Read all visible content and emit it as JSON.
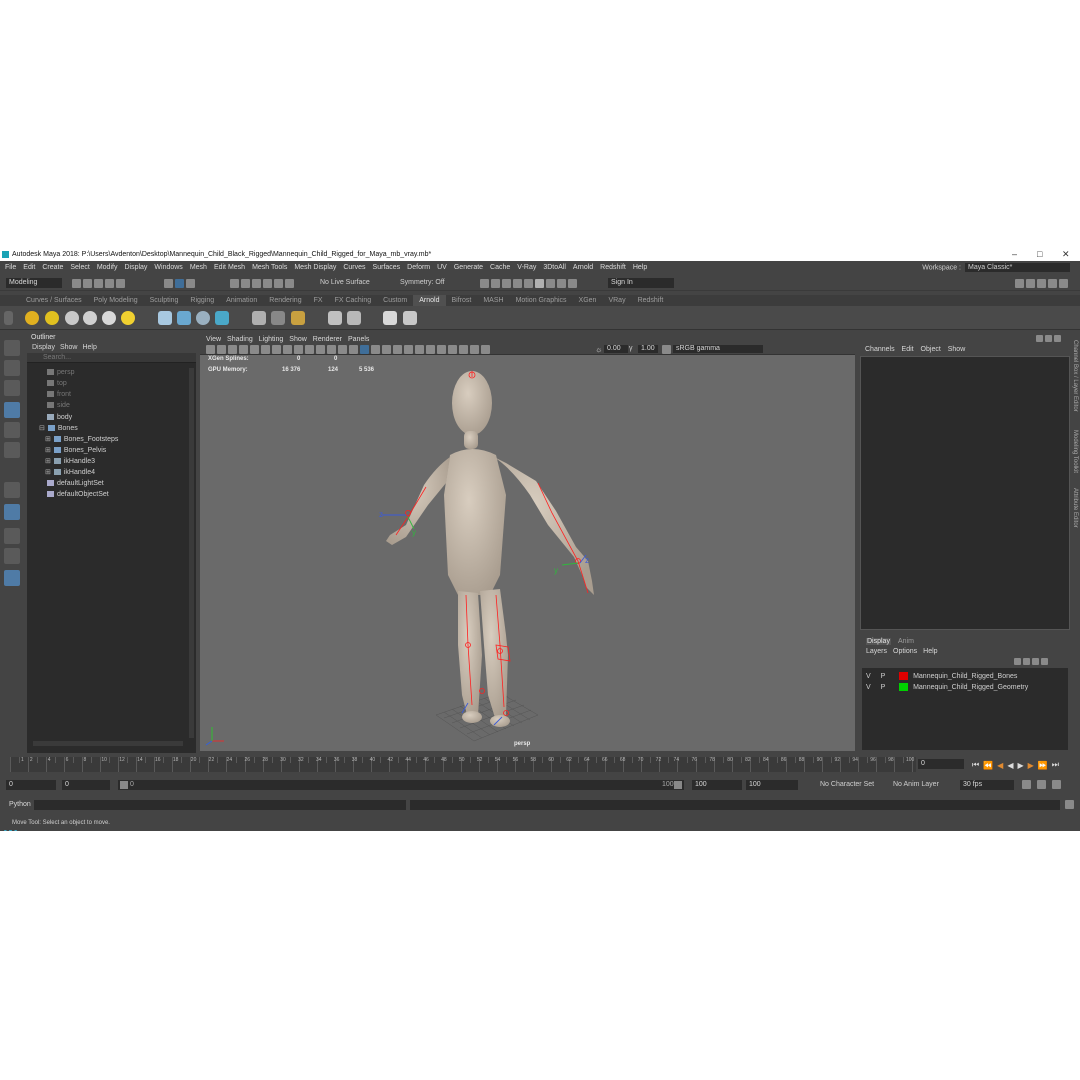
{
  "title": "Autodesk Maya 2018: P:\\Users\\Avdenton\\Desktop\\Mannequin_Child_Black_Rigged\\Mannequin_Child_Rigged_for_Maya_mb_vray.mb*",
  "window_controls": {
    "minimize": "–",
    "maximize": "□",
    "close": "✕"
  },
  "menu": [
    "File",
    "Edit",
    "Create",
    "Select",
    "Modify",
    "Display",
    "Windows",
    "Mesh",
    "Edit Mesh",
    "Mesh Tools",
    "Mesh Display",
    "Curves",
    "Surfaces",
    "Deform",
    "UV",
    "Generate",
    "Cache",
    "V-Ray",
    "3DtoAll",
    "Arnold",
    "Redshift",
    "Help"
  ],
  "workspace": {
    "label": "Workspace :",
    "value": "Maya Classic*"
  },
  "status": {
    "mode": "Modeling",
    "live_surface": "No Live Surface",
    "symmetry": "Symmetry: Off",
    "sign_in": "Sign In"
  },
  "shelf_tabs": [
    "Curves / Surfaces",
    "Poly Modeling",
    "Sculpting",
    "Rigging",
    "Animation",
    "Rendering",
    "FX",
    "FX Caching",
    "Custom",
    "Arnold",
    "Bifrost",
    "MASH",
    "Motion Graphics",
    "XGen",
    "VRay",
    "Redshift"
  ],
  "shelf_active": "Arnold",
  "outliner": {
    "title": "Outliner",
    "menu": [
      "Display",
      "Show",
      "Help"
    ],
    "search": "Search...",
    "items": [
      {
        "label": "persp",
        "dim": true
      },
      {
        "label": "top",
        "dim": true
      },
      {
        "label": "front",
        "dim": true
      },
      {
        "label": "side",
        "dim": true
      },
      {
        "label": "body",
        "dim": false
      },
      {
        "label": "Bones",
        "dim": false
      },
      {
        "label": "Bones_Footsteps",
        "dim": false
      },
      {
        "label": "Bones_Pelvis",
        "dim": false
      },
      {
        "label": "ikHandle3",
        "dim": false
      },
      {
        "label": "ikHandle4",
        "dim": false
      },
      {
        "label": "defaultLightSet",
        "dim": false
      },
      {
        "label": "defaultObjectSet",
        "dim": false
      }
    ]
  },
  "viewport": {
    "menu": [
      "View",
      "Shading",
      "Lighting",
      "Show",
      "Renderer",
      "Panels"
    ],
    "exposure": "0.00",
    "gamma": "1.00",
    "color_space": "sRGB gamma",
    "hud": [
      {
        "label": "XGen Splines:",
        "v1": "0",
        "v2": "0"
      },
      {
        "label": "GPU Memory:",
        "v1": "16 376",
        "v2": "124",
        "v3": "5 536"
      }
    ],
    "camera": "persp",
    "axis_labels": {
      "x": "x",
      "y": "y",
      "z": "z"
    }
  },
  "channel_box": {
    "menu": [
      "Channels",
      "Edit",
      "Object",
      "Show"
    ]
  },
  "layer_editor": {
    "tabs": [
      "Display",
      "Anim"
    ],
    "menu": [
      "Layers",
      "Options",
      "Help"
    ],
    "layers": [
      {
        "v": "V",
        "p": "P",
        "name": "Mannequin_Child_Rigged_Bones",
        "color": "#e00000"
      },
      {
        "v": "V",
        "p": "P",
        "name": "Mannequin_Child_Rigged_Geometry",
        "color": "#00d000"
      }
    ]
  },
  "side_tabs": [
    "Channel Box / Layer Editor",
    "Modeling Toolkit",
    "Attribute Editor"
  ],
  "timeline": {
    "ticks": [
      "1",
      "2",
      "4",
      "6",
      "8",
      "10",
      "12",
      "14",
      "16",
      "18",
      "20",
      "22",
      "24",
      "26",
      "28",
      "30",
      "32",
      "34",
      "36",
      "38",
      "40",
      "42",
      "44",
      "46",
      "48",
      "50",
      "52",
      "54",
      "56",
      "58",
      "60",
      "62",
      "64",
      "66",
      "68",
      "70",
      "72",
      "74",
      "76",
      "78",
      "80",
      "82",
      "84",
      "86",
      "88",
      "90",
      "92",
      "94",
      "96",
      "98",
      "100"
    ],
    "current_frame": "0"
  },
  "range": {
    "start": "0",
    "anim_start": "0",
    "range_start": "0",
    "range_end": "100",
    "end": "100",
    "anim_end": "100",
    "character_set": "No Character Set",
    "anim_layer": "No Anim Layer",
    "fps": "30 fps"
  },
  "command": {
    "language": "Python"
  },
  "help_line": "Move Tool: Select an object to move."
}
